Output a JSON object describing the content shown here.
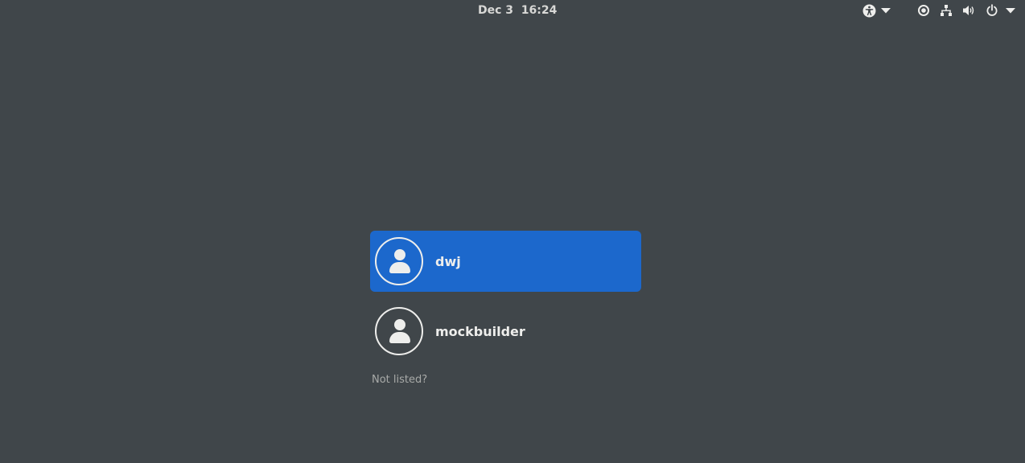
{
  "topbar": {
    "clock": "Dec 3  16:24",
    "icons": [
      "accessibility-icon",
      "chevron-down-icon",
      "system-status-icon",
      "network-icon",
      "volume-icon",
      "power-icon",
      "chevron-down-icon"
    ]
  },
  "users": [
    {
      "name": "dwj",
      "selected": true
    },
    {
      "name": "mockbuilder",
      "selected": false
    }
  ],
  "not_listed_label": "Not listed?",
  "colors": {
    "background": "#40464a",
    "selection": "#1c68cc",
    "text": "#eeeeec"
  }
}
